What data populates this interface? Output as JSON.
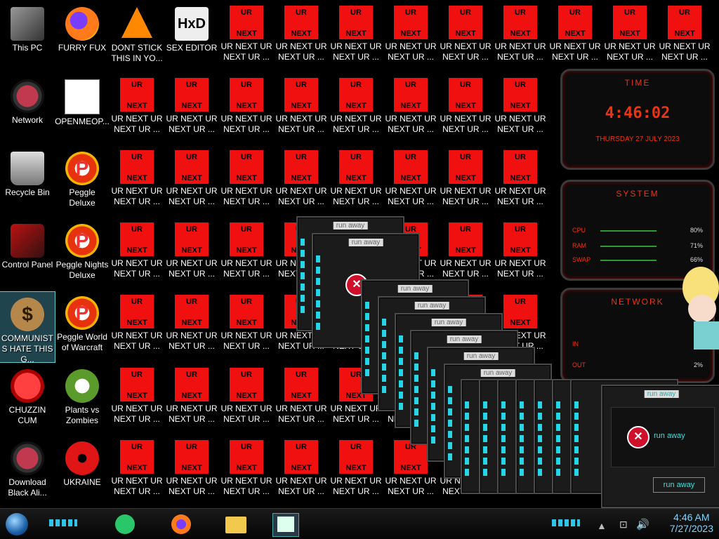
{
  "desktop": {
    "col1": [
      {
        "label": "This PC"
      },
      {
        "label": "Network"
      },
      {
        "label": "Recycle Bin"
      },
      {
        "label": "Control Panel"
      },
      {
        "label": "COMMUNISTS HATE THIS G..."
      },
      {
        "label": "CHUZZIN CUM"
      },
      {
        "label": "Download Black Ali..."
      }
    ],
    "col2": [
      {
        "label": "FURRY FUX"
      },
      {
        "label": "OPENMEOP..."
      },
      {
        "label": "Peggle Deluxe"
      },
      {
        "label": "Peggle Nights Deluxe"
      },
      {
        "label": "Peggle World of Warcraft"
      },
      {
        "label": "Plants vs Zombies"
      },
      {
        "label": "UKRAINE"
      }
    ],
    "row0_extra": [
      {
        "label": "DONT STICK THIS IN YO..."
      },
      {
        "label": "SEX EDITOR"
      }
    ],
    "ur_icon": {
      "top": "UR",
      "bottom": "NEXT",
      "label": "UR NEXT UR NEXT UR ..."
    },
    "hxd_text": "HxD"
  },
  "widgets": {
    "time": {
      "title": "TIME",
      "clock": "4:46:02",
      "date": "THURSDAY 27 JULY 2023"
    },
    "system": {
      "title": "SYSTEM",
      "rows": [
        {
          "k": "CPU",
          "v": "80%"
        },
        {
          "k": "RAM",
          "v": "71%"
        },
        {
          "k": "SWAP",
          "v": "66%"
        }
      ]
    },
    "network": {
      "title": "NETWORK",
      "in_label": "IN",
      "out_label": "OUT",
      "out_val": "2%"
    }
  },
  "dialog": {
    "caption": "run away",
    "message": "run away",
    "button": "run away"
  },
  "taskbar": {
    "time": "4:46 AM",
    "date": "7/27/2023"
  }
}
